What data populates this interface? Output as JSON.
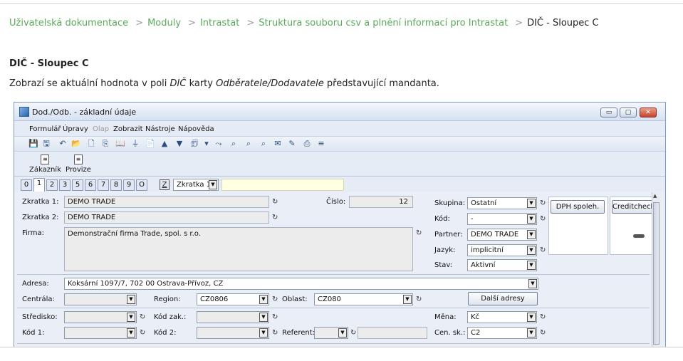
{
  "breadcrumb": {
    "items": [
      "Uživatelská dokumentace",
      "Moduly",
      "Intrastat",
      "Struktura souboru csv a plnění informací pro Intrastat"
    ],
    "separator": ">",
    "current": "DIČ - Sloupec C"
  },
  "doc": {
    "title": "DIČ - Sloupec C",
    "para_start": "Zobrazí se aktuální hodnota v poli ",
    "para_em1": "DIČ",
    "para_mid": " karty ",
    "para_em2": "Odběratele/Dodavatele",
    "para_end": " představující mandanta."
  },
  "window": {
    "title": "Dod./Odb. - základní údaje",
    "btn_min": "▭",
    "btn_max": "▢",
    "btn_close": "✕",
    "menu": [
      "Formulář",
      "Úpravy",
      "Olap",
      "Zobrazit",
      "Nástroje",
      "Nápověda"
    ],
    "toolbar_icons": [
      "💾",
      "🖫",
      "↶",
      "📂",
      "🗋",
      "⎘",
      "📖",
      "⏚",
      "📄",
      "▲",
      "▼",
      "🗊",
      "▾",
      "⤳",
      "⌕",
      "⌕",
      "⌕",
      "✉",
      "✎",
      "⎙",
      "≡"
    ],
    "big_tools": [
      {
        "icon": "≡",
        "label": "Zákazník"
      },
      {
        "icon": "≡",
        "label": "Provize"
      }
    ],
    "tabs": [
      "0",
      "1",
      "2",
      "3",
      "5",
      "6",
      "7",
      "8",
      "9",
      "O"
    ],
    "z_button": "Z",
    "sort_combo": "Zkratka 1",
    "arrow": "▼",
    "hist": "↻",
    "labels": {
      "zkratka1": "Zkratka 1:",
      "zkratka2": "Zkratka 2:",
      "firma": "Firma:",
      "cislo": "Číslo:",
      "skupina": "Skupina:",
      "kod": "Kód:",
      "partner": "Partner:",
      "jazyk": "Jazyk:",
      "stav": "Stav:",
      "adresa": "Adresa:",
      "centrala": "Centrála:",
      "region": "Region:",
      "oblast": "Oblast:",
      "stredisko": "Středisko:",
      "kod_zak": "Kód zak.:",
      "mena": "Měna:",
      "kod1": "Kód 1:",
      "kod2": "Kód 2:",
      "referent": "Referent:",
      "cen_sk": "Cen. sk.:"
    },
    "values": {
      "zkratka1": "DEMO TRADE",
      "zkratka2": "DEMO TRADE",
      "firma": "Demonstrační firma Trade, spol. s r.o.",
      "cislo": "12",
      "skupina": "Ostatní",
      "kod": "-",
      "partner": "DEMO TRADE",
      "jazyk": "implicitní",
      "stav": "Aktivní",
      "adresa": "Koksární 1097/7, 702 00  Ostrava-Přívoz, CZ",
      "region": "CZ0806",
      "oblast": "CZ080",
      "mena": "Kč",
      "cen_sk": "C2"
    },
    "buttons": {
      "dph": "DPH spoleh.",
      "creditcheck": "Creditcheck",
      "dalsi_adresy": "Další adresy"
    }
  }
}
